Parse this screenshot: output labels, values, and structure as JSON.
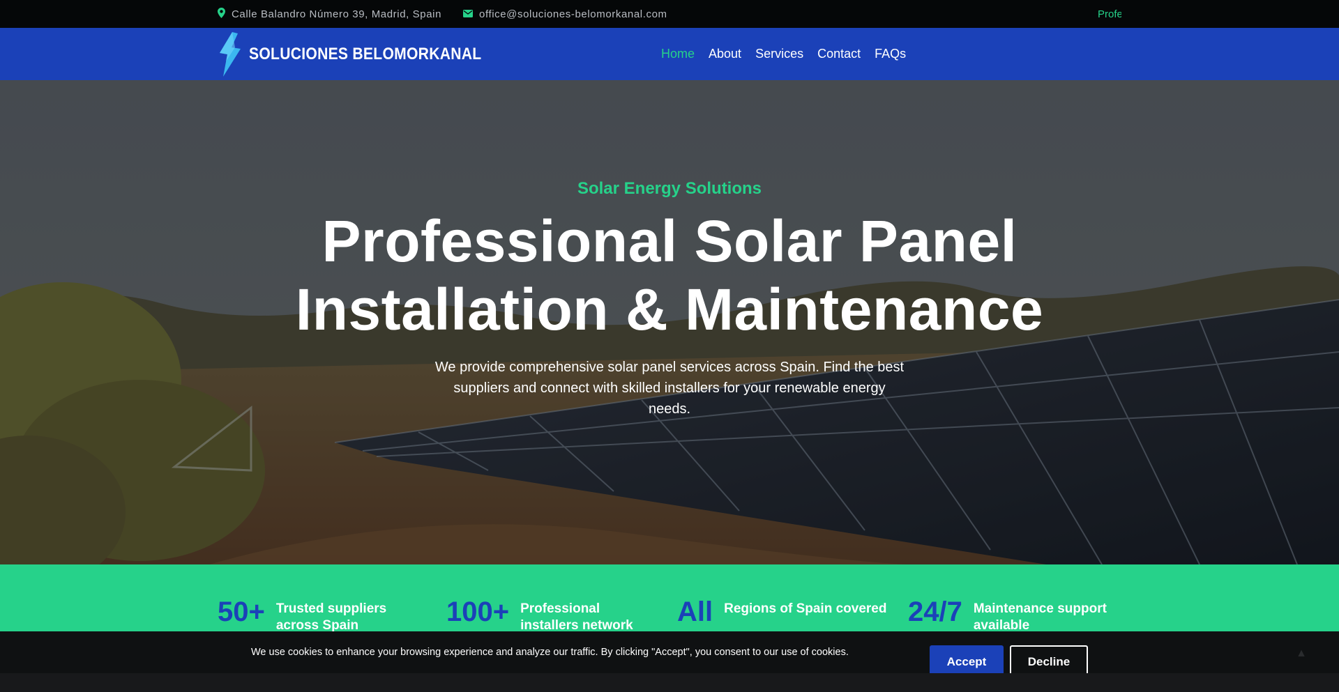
{
  "topbar": {
    "address": "Calle Balandro Número 39, Madrid, Spain",
    "email": "office@soluciones-belomorkanal.com",
    "ticker": "Profe",
    "location_icon": "map-pin-icon",
    "email_icon": "envelope-icon"
  },
  "navbar": {
    "brand": "SOLUCIONES BELOMORKANAL",
    "logo_icon": "lightning-bolt-icon",
    "items": [
      {
        "label": "Home"
      },
      {
        "label": "About"
      },
      {
        "label": "Services"
      },
      {
        "label": "Contact"
      },
      {
        "label": "FAQs"
      }
    ],
    "active_item": "Home"
  },
  "hero": {
    "kicker": "Solar Energy Solutions",
    "title_line1": "Professional Solar Panel",
    "title_line2": "Installation & Maintenance",
    "description": "We provide comprehensive solar panel services across Spain. Find the best suppliers and connect with skilled installers for your renewable energy needs."
  },
  "stats": [
    {
      "number": "50+",
      "label_line1": "Trusted suppliers",
      "label_line2": "across Spain"
    },
    {
      "number": "100+",
      "label_line1": "Professional",
      "label_line2": "installers network"
    },
    {
      "number": "All",
      "label_line1": "Regions of Spain covered",
      "label_line2": ""
    },
    {
      "number": "24/7",
      "label_line1": "Maintenance support",
      "label_line2": "available"
    }
  ],
  "cookie_banner": {
    "message": "We use cookies to enhance your browsing experience and analyze our traffic. By clicking \"Accept\", you consent to our use of cookies.",
    "accept_label": "Accept",
    "decline_label": "Decline"
  },
  "colors": {
    "brand_blue": "#1b41b8",
    "accent_green": "#26d28a",
    "topbar_bg": "#050708",
    "cookie_bg": "#0f1112"
  }
}
